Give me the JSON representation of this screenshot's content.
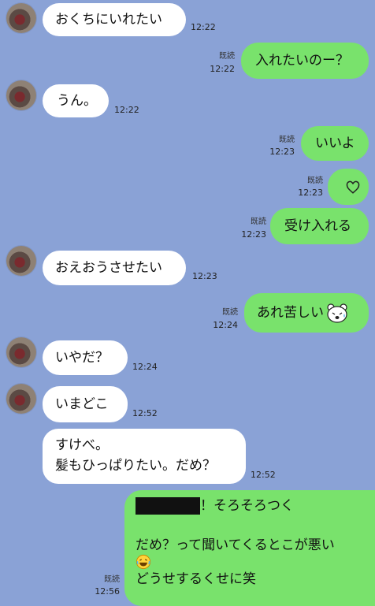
{
  "messages": [
    {
      "text": "おくちにいれたい",
      "time": "12:22"
    },
    {
      "text": "入れたいのー？",
      "read": "既読",
      "time": "12:22"
    },
    {
      "text": "うん。",
      "time": "12:22"
    },
    {
      "text": "いいよ",
      "read": "既読",
      "time": "12:23"
    },
    {
      "text": "",
      "read": "既読",
      "time": "12:23",
      "icon": "heart-icon"
    },
    {
      "text": "受け入れる",
      "read": "既読",
      "time": "12:23"
    },
    {
      "text": "おえおうさせたい",
      "time": "12:23"
    },
    {
      "text": "あれ苦しい",
      "read": "既読",
      "time": "12:24",
      "icon": "bear-sticker-icon"
    },
    {
      "text": "いやだ？",
      "time": "12:24"
    },
    {
      "text": "いまどこ",
      "time": "12:52"
    },
    {
      "lines": [
        "すけべ。",
        "髪もひっぱりたい。だめ？"
      ],
      "time": "12:52"
    },
    {
      "redacted": true,
      "lines": [
        "！そろそろつく",
        "だめ？って聞いてくるとこが悪い",
        "どうせするくせに笑"
      ],
      "read": "既読",
      "time": "12:56",
      "icon": "laughing-emoji-icon"
    }
  ],
  "colors": {
    "background": "#8aa2d6",
    "incoming": "#ffffff",
    "outgoing": "#79e26c"
  }
}
